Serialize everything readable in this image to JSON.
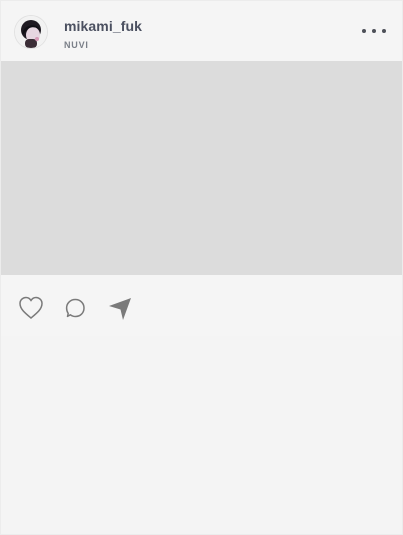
{
  "post": {
    "username": "mikami_fuk",
    "location": "NUVI"
  },
  "icons": {
    "avatar": "profile-avatar",
    "more": "more-options-icon",
    "like": "heart-icon",
    "comment": "comment-bubble-icon",
    "share": "send-arrow-icon"
  },
  "colors": {
    "media_placeholder": "#dcdcdc",
    "page_background": "#f5f5f5",
    "icon": "#7a7a7a",
    "username": "#4b5060"
  }
}
